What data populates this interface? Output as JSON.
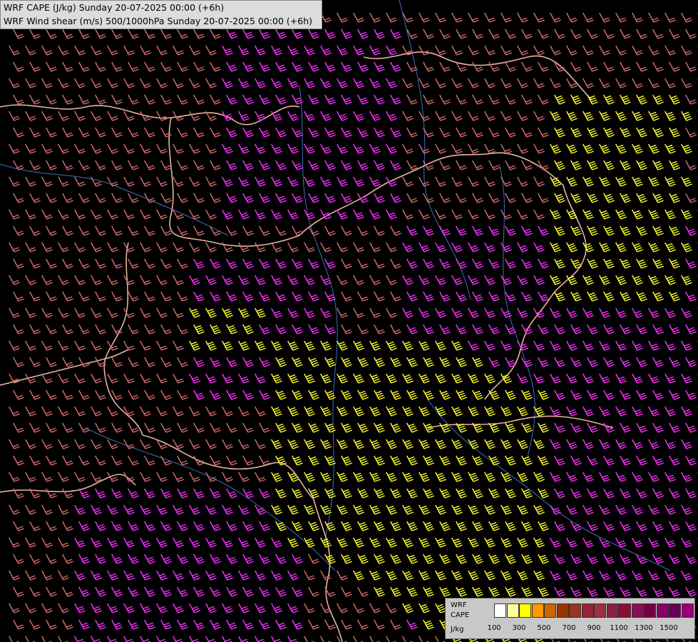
{
  "title": {
    "line1": "WRF CAPE (J/kg) Sunday 20-07-2025 00:00 (+6h)",
    "line2": "WRF Wind shear (m/s) 500/1000hPa Sunday 20-07-2025 00:00 (+6h)"
  },
  "legend": {
    "label_model": "WRF",
    "label_field": "CAPE",
    "label_unit": "J/kg",
    "swatch_colors": [
      "#ffffff",
      "#ffff99",
      "#ffff00",
      "#ff9900",
      "#cc6600",
      "#993300",
      "#993322",
      "#992233",
      "#993344",
      "#882244",
      "#881133",
      "#881155",
      "#770044",
      "#880066",
      "#660055",
      "#990077"
    ],
    "ticks": [
      "100",
      "300",
      "500",
      "700",
      "900",
      "1100",
      "1300",
      "1500"
    ]
  },
  "map": {
    "shear_colors": {
      "low": "#d86f6f",
      "mid": "#ff33ff",
      "high": "#ffff33",
      "pale": "#ff8080"
    },
    "border_color": "#e8b4a0",
    "river_color": "#4a78c8"
  }
}
